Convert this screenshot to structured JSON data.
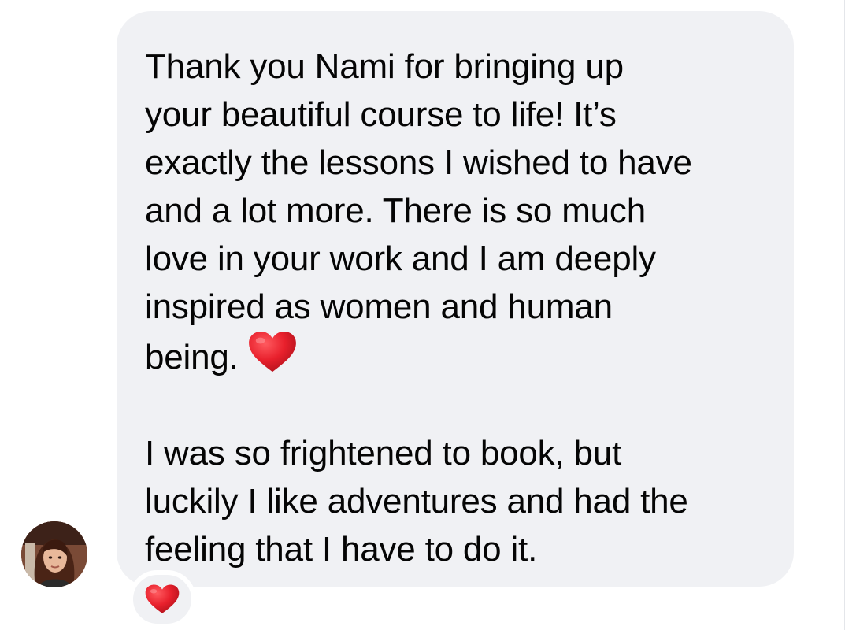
{
  "message": {
    "lines_para1": [
      "Thank you Nami for bringing up",
      "your beautiful course to life! It’s",
      "exactly the lessons I wished to have",
      "and a lot more. There is so much",
      "love in your work and I am deeply",
      "inspired as women and human",
      "being."
    ],
    "lines_para2": [
      "I was so frightened to book, but",
      "luckily I like adventures and had the",
      "feeling that I have to do it."
    ],
    "inline_emoji": "heart-icon"
  },
  "reaction": {
    "emoji": "heart-icon",
    "count": null
  },
  "sender": {
    "avatar": "avatar"
  },
  "colors": {
    "bubble": "#f0f1f4",
    "text": "#050505",
    "heart": "#e8202c"
  }
}
